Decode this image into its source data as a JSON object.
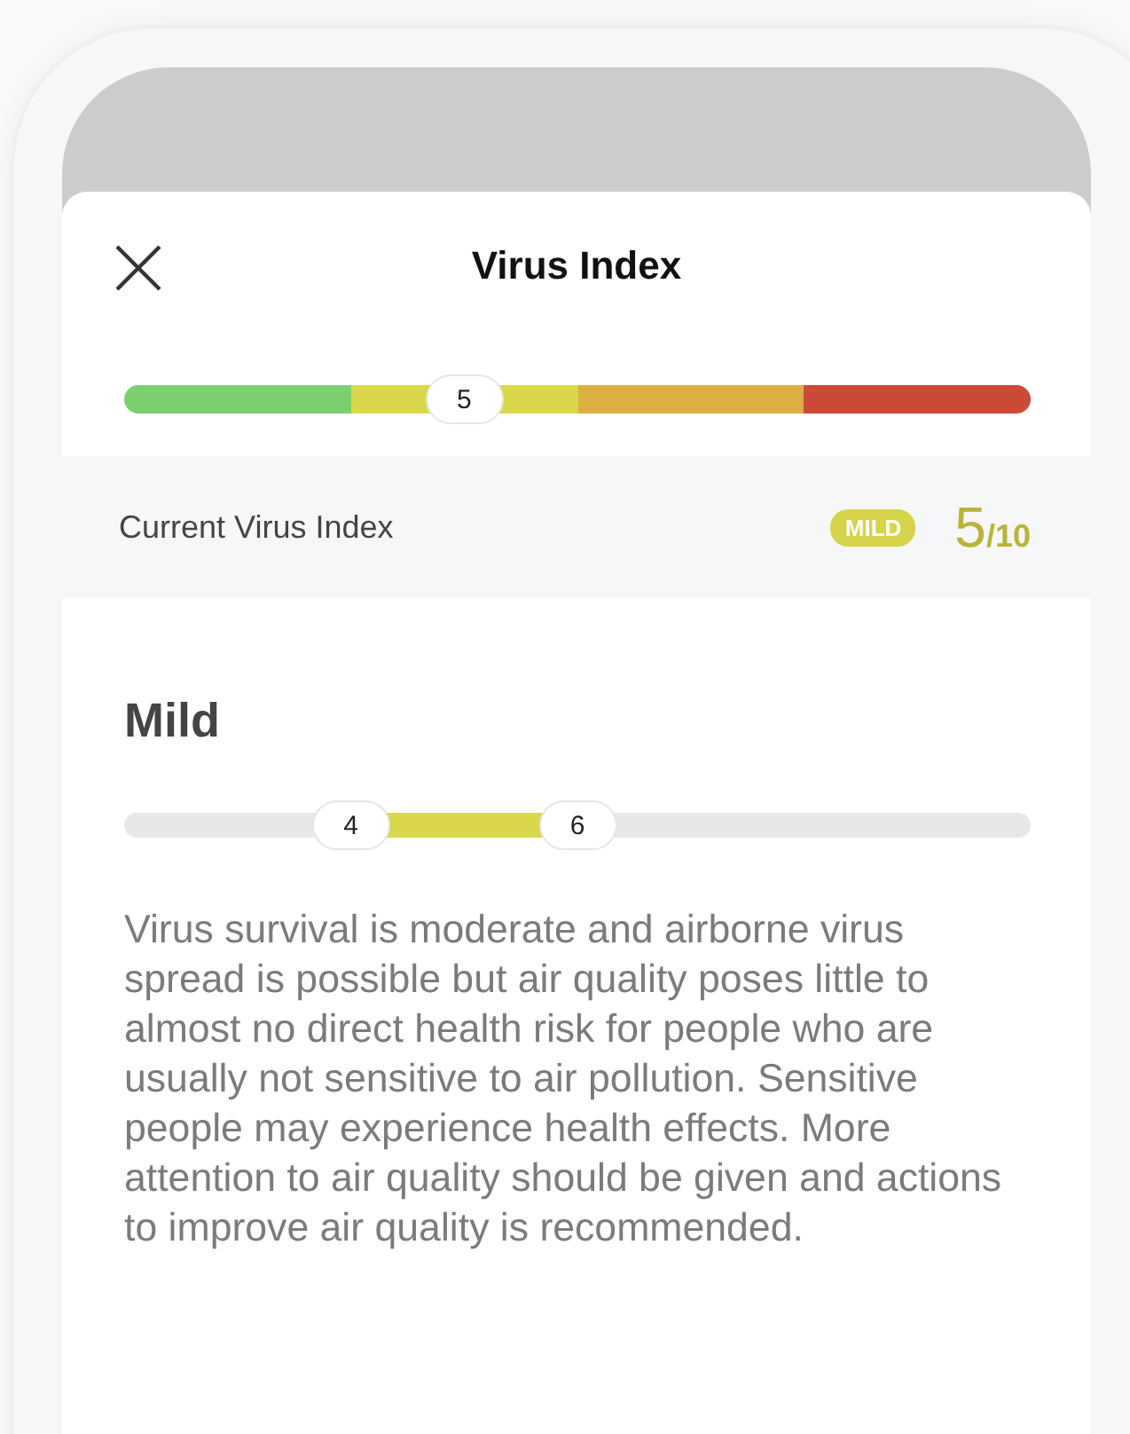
{
  "header": {
    "title": "Virus Index"
  },
  "scale": {
    "segments": [
      {
        "color": "#7ad16e"
      },
      {
        "color": "#d8d84a"
      },
      {
        "color": "#dcae44"
      },
      {
        "color": "#cc4a38"
      }
    ],
    "thumb": {
      "label": "5",
      "level": 0.375
    }
  },
  "current": {
    "label": "Current Virus Index",
    "badge": "MILD",
    "score": "5",
    "max": "/10"
  },
  "detail": {
    "title": "Mild",
    "range": [
      {
        "label": "4",
        "level": 0.25
      },
      {
        "label": "6",
        "level": 0.5
      }
    ],
    "description": "Virus survival is moderate and airborne virus spread is possible but air quality poses little to almost no direct health risk for people who are usually not sensitive to air pollution. Sensitive people may experience health effects. More attention to air quality should be given and actions to improve air quality is recommended."
  }
}
